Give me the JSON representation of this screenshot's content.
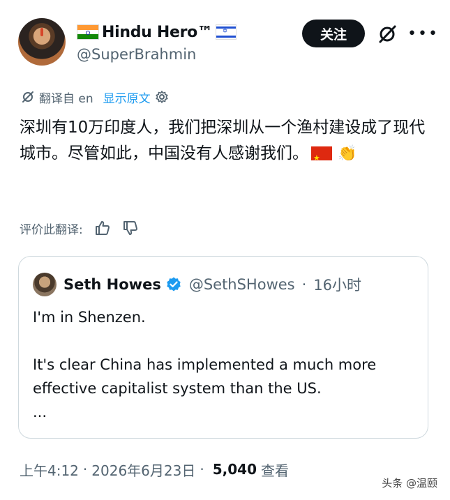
{
  "author": {
    "display_name": "Hindu Hero™",
    "handle": "@SuperBrahmin",
    "follow_label": "关注"
  },
  "translation": {
    "from_label": "翻译自 en",
    "show_original": "显示原文"
  },
  "tweet": {
    "text": "深圳有10万印度人，我们把深圳从一个渔村建设成了现代城市。尽管如此，中国没有人感谢我们。"
  },
  "rating": {
    "label": "评价此翻译:"
  },
  "quote": {
    "name": "Seth Howes",
    "handle": "@SethSHowes",
    "separator": "·",
    "time": "16小时",
    "lines": [
      "I'm in Shenzen.",
      "",
      "It's clear China has implemented a much more effective capitalist system than the US.",
      "..."
    ]
  },
  "footer": {
    "time": "上午4:12",
    "sep1": "·",
    "date": "2026年6月23日",
    "sep2": "·",
    "views_count": "5,040",
    "views_label": "查看"
  },
  "watermark": "头条 @温颐",
  "colors": {
    "accent": "#1d9bf0",
    "text": "#0f1419",
    "muted": "#536471"
  }
}
